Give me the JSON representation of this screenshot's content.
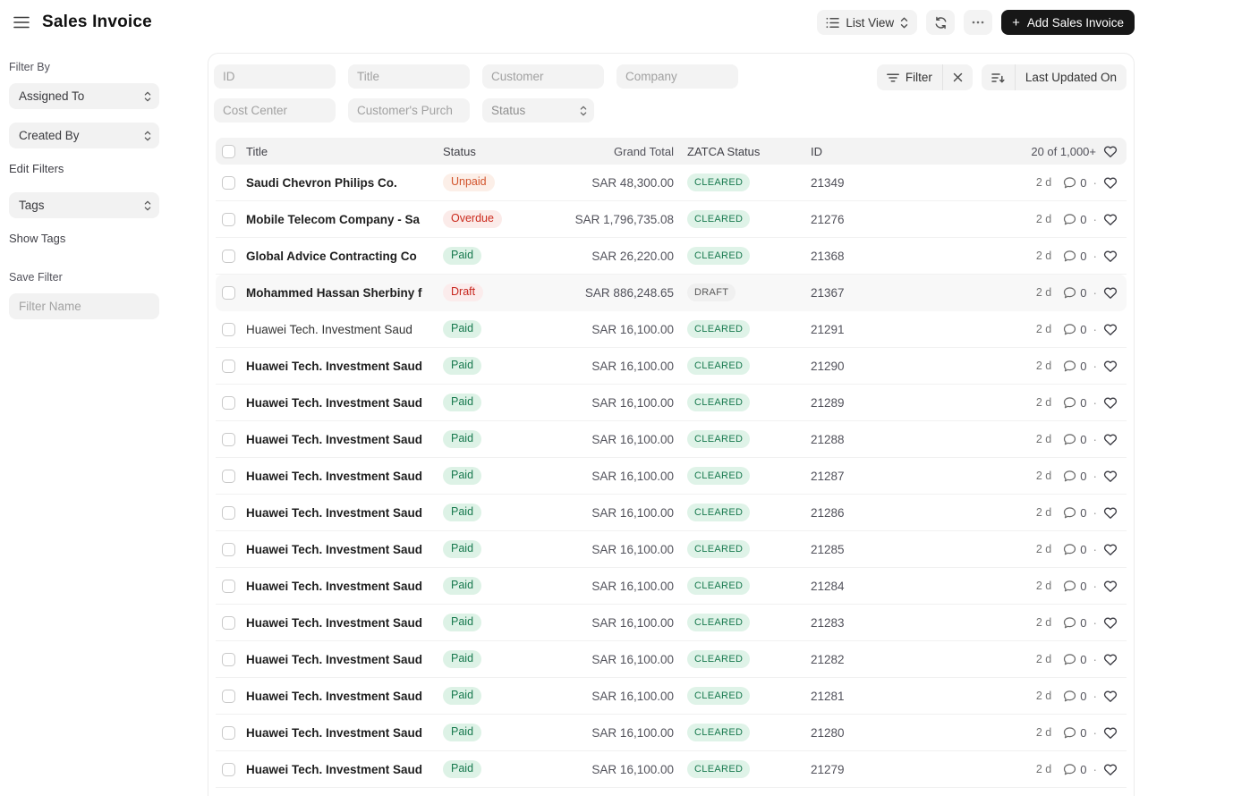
{
  "topbar": {
    "title": "Sales Invoice",
    "view_switcher_label": "List View",
    "ellipsis_label": "···",
    "add_button_label": "Add Sales Invoice",
    "add_button_plus": "+"
  },
  "sidebar": {
    "filter_by_label": "Filter By",
    "assigned_to_label": "Assigned To",
    "created_by_label": "Created By",
    "edit_filters_label": "Edit Filters",
    "tags_label": "Tags",
    "show_tags_label": "Show Tags",
    "save_filter_label": "Save Filter",
    "filter_name_placeholder": "Filter Name"
  },
  "filters": {
    "id_placeholder": "ID",
    "title_placeholder": "Title",
    "customer_placeholder": "Customer",
    "company_placeholder": "Company",
    "cost_center_placeholder": "Cost Center",
    "customers_purchase_placeholder": "Customer's Purch",
    "status_placeholder": "Status",
    "filter_button_label": "Filter",
    "sort_label": "Last Updated On"
  },
  "table": {
    "columns": {
      "title": "Title",
      "status": "Status",
      "grand_total": "Grand Total",
      "zatca": "ZATCA Status",
      "id": "ID"
    },
    "count_label": "20 of 1,000+",
    "rows": [
      {
        "title": "Saudi Chevron Philips Co.",
        "status": "Unpaid",
        "grand_total": "SAR 48,300.00",
        "zatca": "CLEARED",
        "id": "21349",
        "updated": "2 d",
        "comments": "0",
        "seen": false,
        "highlighted": false
      },
      {
        "title": "Mobile Telecom Company - Sa",
        "status": "Overdue",
        "grand_total": "SAR 1,796,735.08",
        "zatca": "CLEARED",
        "id": "21276",
        "updated": "2 d",
        "comments": "0",
        "seen": false,
        "highlighted": false
      },
      {
        "title": "Global Advice Contracting Co",
        "status": "Paid",
        "grand_total": "SAR 26,220.00",
        "zatca": "CLEARED",
        "id": "21368",
        "updated": "2 d",
        "comments": "0",
        "seen": false,
        "highlighted": false
      },
      {
        "title": "Mohammed Hassan Sherbiny f",
        "status": "Draft",
        "grand_total": "SAR 886,248.65",
        "zatca": "DRAFT",
        "id": "21367",
        "updated": "2 d",
        "comments": "0",
        "seen": false,
        "highlighted": true
      },
      {
        "title": "Huawei Tech. Investment Saud",
        "status": "Paid",
        "grand_total": "SAR 16,100.00",
        "zatca": "CLEARED",
        "id": "21291",
        "updated": "2 d",
        "comments": "0",
        "seen": true,
        "highlighted": false
      },
      {
        "title": "Huawei Tech. Investment Saud",
        "status": "Paid",
        "grand_total": "SAR 16,100.00",
        "zatca": "CLEARED",
        "id": "21290",
        "updated": "2 d",
        "comments": "0",
        "seen": false,
        "highlighted": false
      },
      {
        "title": "Huawei Tech. Investment Saud",
        "status": "Paid",
        "grand_total": "SAR 16,100.00",
        "zatca": "CLEARED",
        "id": "21289",
        "updated": "2 d",
        "comments": "0",
        "seen": false,
        "highlighted": false
      },
      {
        "title": "Huawei Tech. Investment Saud",
        "status": "Paid",
        "grand_total": "SAR 16,100.00",
        "zatca": "CLEARED",
        "id": "21288",
        "updated": "2 d",
        "comments": "0",
        "seen": false,
        "highlighted": false
      },
      {
        "title": "Huawei Tech. Investment Saud",
        "status": "Paid",
        "grand_total": "SAR 16,100.00",
        "zatca": "CLEARED",
        "id": "21287",
        "updated": "2 d",
        "comments": "0",
        "seen": false,
        "highlighted": false
      },
      {
        "title": "Huawei Tech. Investment Saud",
        "status": "Paid",
        "grand_total": "SAR 16,100.00",
        "zatca": "CLEARED",
        "id": "21286",
        "updated": "2 d",
        "comments": "0",
        "seen": false,
        "highlighted": false
      },
      {
        "title": "Huawei Tech. Investment Saud",
        "status": "Paid",
        "grand_total": "SAR 16,100.00",
        "zatca": "CLEARED",
        "id": "21285",
        "updated": "2 d",
        "comments": "0",
        "seen": false,
        "highlighted": false
      },
      {
        "title": "Huawei Tech. Investment Saud",
        "status": "Paid",
        "grand_total": "SAR 16,100.00",
        "zatca": "CLEARED",
        "id": "21284",
        "updated": "2 d",
        "comments": "0",
        "seen": false,
        "highlighted": false
      },
      {
        "title": "Huawei Tech. Investment Saud",
        "status": "Paid",
        "grand_total": "SAR 16,100.00",
        "zatca": "CLEARED",
        "id": "21283",
        "updated": "2 d",
        "comments": "0",
        "seen": false,
        "highlighted": false
      },
      {
        "title": "Huawei Tech. Investment Saud",
        "status": "Paid",
        "grand_total": "SAR 16,100.00",
        "zatca": "CLEARED",
        "id": "21282",
        "updated": "2 d",
        "comments": "0",
        "seen": false,
        "highlighted": false
      },
      {
        "title": "Huawei Tech. Investment Saud",
        "status": "Paid",
        "grand_total": "SAR 16,100.00",
        "zatca": "CLEARED",
        "id": "21281",
        "updated": "2 d",
        "comments": "0",
        "seen": false,
        "highlighted": false
      },
      {
        "title": "Huawei Tech. Investment Saud",
        "status": "Paid",
        "grand_total": "SAR 16,100.00",
        "zatca": "CLEARED",
        "id": "21280",
        "updated": "2 d",
        "comments": "0",
        "seen": false,
        "highlighted": false
      },
      {
        "title": "Huawei Tech. Investment Saud",
        "status": "Paid",
        "grand_total": "SAR 16,100.00",
        "zatca": "CLEARED",
        "id": "21279",
        "updated": "2 d",
        "comments": "0",
        "seen": false,
        "highlighted": false
      }
    ]
  },
  "colors": {
    "accent_dark": "#171717",
    "status": {
      "Unpaid": {
        "fg": "#d2542c",
        "bg": "#fcefe8"
      },
      "Overdue": {
        "fg": "#cb2a1d",
        "bg": "#fbebe9"
      },
      "Paid": {
        "fg": "#17794e",
        "bg": "#ddf2e6"
      },
      "Draft": {
        "fg": "#c7251d",
        "bg": "#fbecec"
      }
    },
    "zatca": {
      "CLEARED": {
        "fg": "#17794e",
        "bg": "#dff3e8"
      },
      "DRAFT": {
        "fg": "#595959",
        "bg": "#f0f0f0"
      }
    }
  }
}
